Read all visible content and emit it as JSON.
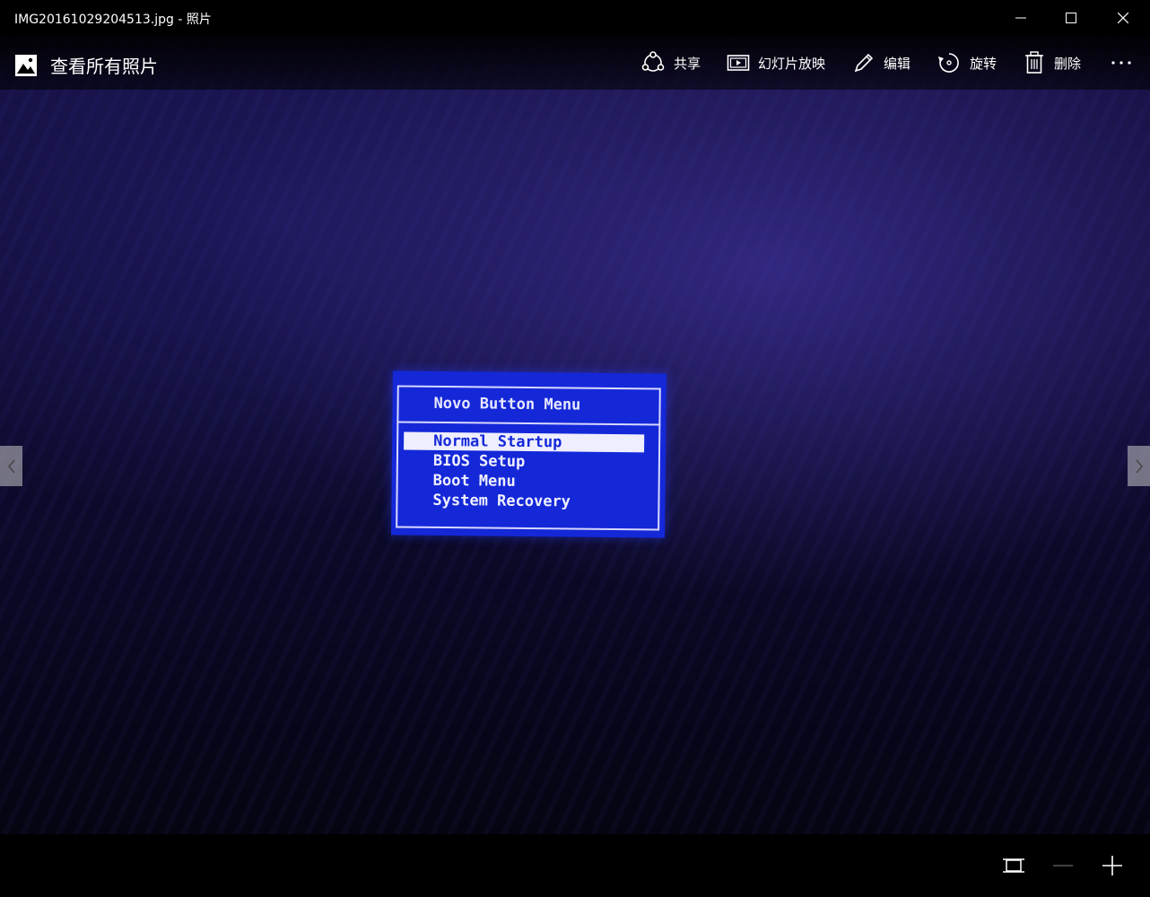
{
  "window": {
    "title": "IMG20161029204513.jpg - 照片"
  },
  "appbar": {
    "gallery_label": "查看所有照片",
    "commands": [
      {
        "label": "共享",
        "icon": "share-icon"
      },
      {
        "label": "幻灯片放映",
        "icon": "slideshow-icon"
      },
      {
        "label": "编辑",
        "icon": "pencil-icon"
      },
      {
        "label": "旋转",
        "icon": "rotate-icon"
      },
      {
        "label": "删除",
        "icon": "trash-icon"
      }
    ],
    "more_icon": "more-icon"
  },
  "photo": {
    "bios_menu": {
      "title": "Novo Button Menu",
      "items": [
        "Normal Startup",
        "BIOS Setup",
        "Boot Menu",
        "System Recovery"
      ],
      "selected_index": 0
    }
  },
  "colors": {
    "bios_blue": "#1428d8",
    "background": "#000000"
  }
}
